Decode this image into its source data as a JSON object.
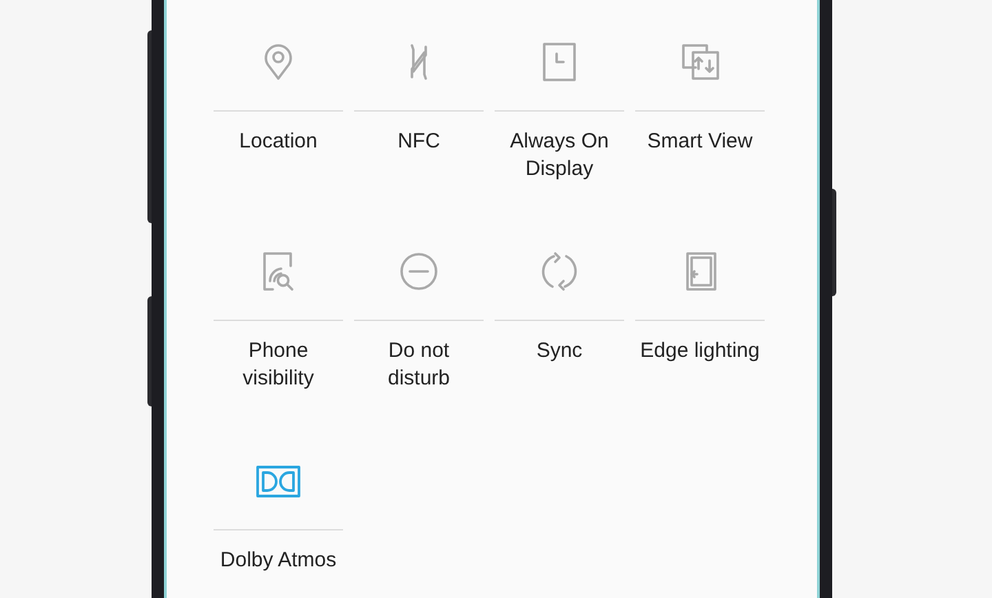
{
  "tiles": [
    {
      "kind": "location",
      "label": "Location",
      "on": false
    },
    {
      "kind": "nfc",
      "label": "NFC",
      "on": false
    },
    {
      "kind": "always_on_display",
      "label": "Always On\nDisplay",
      "on": false
    },
    {
      "kind": "smart_view",
      "label": "Smart View",
      "on": false
    },
    {
      "kind": "phone_visibility",
      "label": "Phone\nvisibility",
      "on": false
    },
    {
      "kind": "do_not_disturb",
      "label": "Do not\ndisturb",
      "on": false
    },
    {
      "kind": "sync",
      "label": "Sync",
      "on": false
    },
    {
      "kind": "edge_lighting",
      "label": "Edge lighting",
      "on": false
    },
    {
      "kind": "dolby",
      "label": "Dolby Atmos",
      "on": true
    }
  ]
}
